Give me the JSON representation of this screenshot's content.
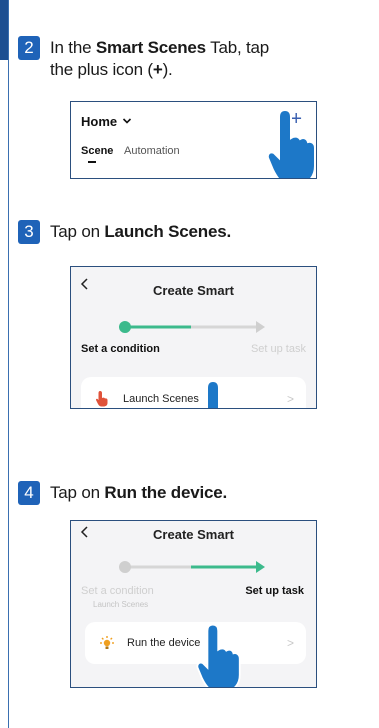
{
  "steps": [
    {
      "number": "2",
      "pre": "In the ",
      "bold": "Smart Scenes",
      "post": " Tab, tap",
      "line2_pre": "the plus icon (",
      "line2_bold": "+",
      "line2_post": ")."
    },
    {
      "number": "3",
      "pre": "Tap on ",
      "bold": "Launch Scenes."
    },
    {
      "number": "4",
      "pre": "Tap on ",
      "bold": "Run the device."
    }
  ],
  "screen_home": {
    "home_label": "Home",
    "plus_symbol": "+",
    "tab_scene": "Scene",
    "tab_automation": "Automation"
  },
  "screen_launch": {
    "title": "Create Smart",
    "back_symbol": "<",
    "step1_label": "Set a condition",
    "step2_label": "Set up task",
    "option_label": "Launch Scenes",
    "option_chevron": ">"
  },
  "screen_run": {
    "title": "Create Smart",
    "back_symbol": "<",
    "step1_label": "Set a condition",
    "step1_sub": "Launch Scenes",
    "step2_label": "Set up task",
    "option_label": "Run the device",
    "option_chevron": ">"
  },
  "colors": {
    "badge": "#1f63b8",
    "frame_border": "#2b4f7e",
    "progress_green": "#3cba8c",
    "progress_gray": "#d6d6d6",
    "hand_blue": "#1d78c8",
    "launch_icon": "#e0523a",
    "device_icon": "#f0a020"
  }
}
